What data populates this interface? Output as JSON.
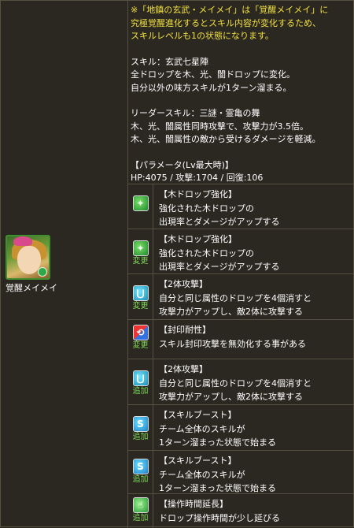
{
  "monster": {
    "name": "覚醒メイメイ"
  },
  "info": {
    "note_lines": [
      "※「地鎮の玄武・メイメイ」は「覚醒メイメイ」に",
      "究極覚醒進化するとスキル内容が変化するため、",
      "スキルレベルも1の状態になります。"
    ],
    "skill_lines": [
      "スキル：玄武七星陣",
      "全ドロップを木、光、闇ドロップに変化。",
      "自分以外の味方スキルが1ターン溜まる。"
    ],
    "leader_lines": [
      "リーダースキル：三謎・霊亀の舞",
      "木、光、闇属性同時攻撃で、攻撃力が3.5倍。",
      "木、光、闇属性の敵から受けるダメージを軽減。"
    ],
    "param_lines": [
      "【パラメータ(Lv最大時)】",
      "HP:4075 / 攻撃:1704 / 回復:106"
    ]
  },
  "awakenings": [
    {
      "icon": "wood-drop-enhance-icon",
      "tag": "",
      "title": "【木ドロップ強化】",
      "lines": [
        "強化された木ドロップの",
        "出現率とダメージがアップする"
      ]
    },
    {
      "icon": "wood-drop-enhance-icon",
      "tag": "変更",
      "title": "【木ドロップ強化】",
      "lines": [
        "強化された木ドロップの",
        "出現率とダメージがアップする"
      ]
    },
    {
      "icon": "two-pronged-attack-icon",
      "tag": "変更",
      "title": "【2体攻撃】",
      "lines": [
        "自分と同じ属性のドロップを4個消すと",
        "攻撃力がアップし、敵2体に攻撃する"
      ]
    },
    {
      "icon": "bind-resistance-icon",
      "tag": "変更",
      "title": "【封印耐性】",
      "lines": [
        "スキル封印攻撃を無効化する事がある"
      ]
    },
    {
      "icon": "two-pronged-attack-icon",
      "tag": "追加",
      "title": "【2体攻撃】",
      "lines": [
        "自分と同じ属性のドロップを4個消すと",
        "攻撃力がアップし、敵2体に攻撃する"
      ]
    },
    {
      "icon": "skill-boost-icon",
      "tag": "追加",
      "title": "【スキルブースト】",
      "lines": [
        "チーム全体のスキルが",
        "1ターン溜まった状態で始まる"
      ]
    },
    {
      "icon": "skill-boost-icon",
      "tag": "追加",
      "title": "【スキルブースト】",
      "lines": [
        "チーム全体のスキルが",
        "1ターン溜まった状態で始まる"
      ]
    },
    {
      "icon": "time-extend-icon",
      "tag": "追加",
      "title": "【操作時間延長】",
      "lines": [
        "ドロップ操作時間が少し延びる"
      ]
    }
  ]
}
